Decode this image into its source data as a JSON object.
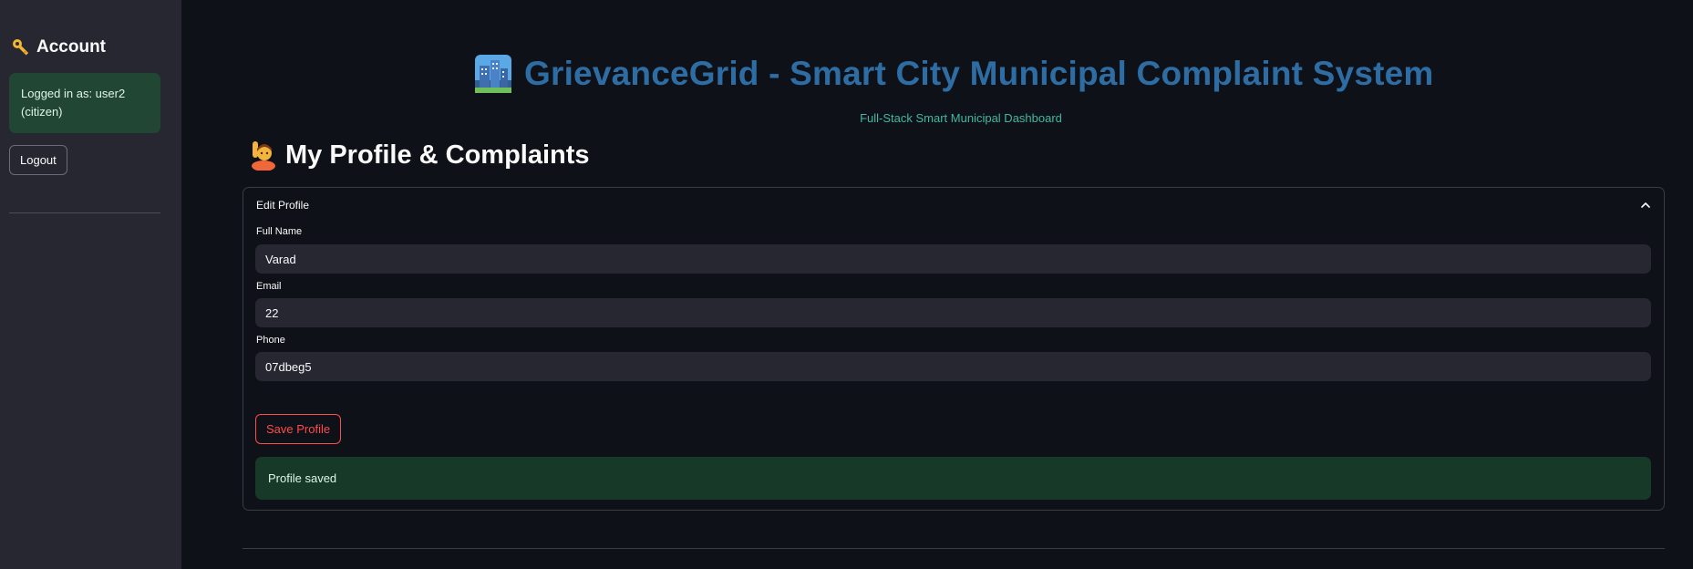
{
  "sidebar": {
    "title": "Account",
    "title_icon": "key-icon",
    "status_line1": "Logged in as: user2",
    "status_line2": "(citizen)",
    "logout_label": "Logout"
  },
  "header": {
    "title": "GrievanceGrid - Smart City Municipal Complaint System",
    "title_icon": "city-icon",
    "subtitle": "Full-Stack Smart Municipal Dashboard"
  },
  "section": {
    "title": "My Profile & Complaints",
    "title_icon": "person-raising-hand-icon"
  },
  "expander": {
    "label": "Edit Profile",
    "expanded": true
  },
  "form": {
    "full_name_label": "Full Name",
    "full_name_value": "Varad",
    "email_label": "Email",
    "email_value": "22",
    "phone_label": "Phone",
    "phone_value": "07dbeg5",
    "save_label": "Save Profile"
  },
  "alert": {
    "message": "Profile saved"
  },
  "colors": {
    "background": "#0e1117",
    "sidebar": "#262730",
    "title_blue": "#2e6da4",
    "subtitle_teal": "#3fb8a3",
    "success_bg": "#173928",
    "primary_red": "#ff4b4b"
  }
}
